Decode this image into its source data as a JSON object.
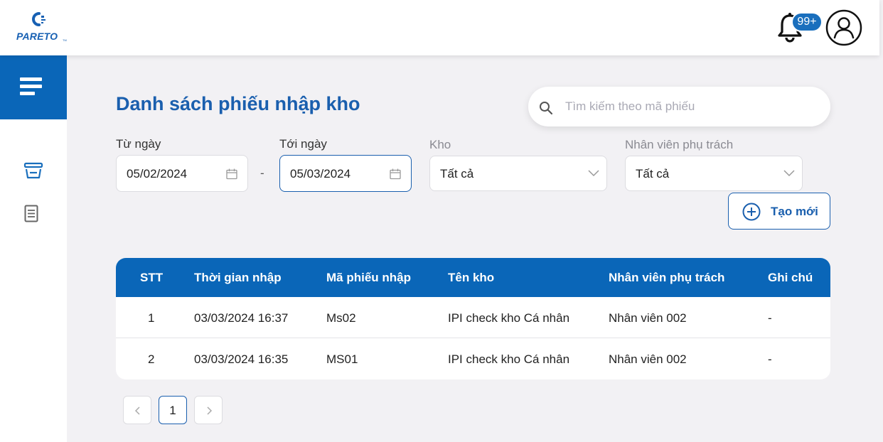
{
  "app": {
    "logo_text": "PARETO",
    "logo_tm": "TM"
  },
  "header": {
    "notification_count": "99+"
  },
  "page": {
    "title": "Danh sách phiếu nhập kho"
  },
  "search": {
    "placeholder": "Tìm kiếm theo mã phiếu",
    "value": ""
  },
  "filters": {
    "from_date": {
      "label": "Từ ngày",
      "value": "05/02/2024"
    },
    "separator": "-",
    "to_date": {
      "label": "Tới ngày",
      "value": "05/03/2024"
    },
    "warehouse": {
      "label": "Kho",
      "value": "Tất cả"
    },
    "staff": {
      "label": "Nhân viên phụ trách",
      "value": "Tất cả"
    }
  },
  "actions": {
    "create_label": "Tạo mới"
  },
  "table": {
    "columns": [
      "STT",
      "Thời gian nhập",
      "Mã phiếu nhập",
      "Tên kho",
      "Nhân viên phụ trách",
      "Ghi chú"
    ],
    "rows": [
      [
        "1",
        "03/03/2024 16:37",
        "Ms02",
        "IPI check kho Cá nhân",
        "Nhân viên 002",
        "-"
      ],
      [
        "2",
        "03/03/2024 16:35",
        "MS01",
        "IPI check kho Cá nhân",
        "Nhân viên 002",
        "-"
      ]
    ]
  },
  "pagination": {
    "current_page": "1"
  },
  "colors": {
    "primary": "#0a66b8",
    "title": "#1a5fae",
    "background": "#f2f1f4"
  },
  "icons": {
    "sidebar": [
      "menu-icon",
      "warehouse-basket-icon",
      "document-icon"
    ],
    "header": [
      "bell-icon",
      "user-avatar-icon"
    ]
  }
}
